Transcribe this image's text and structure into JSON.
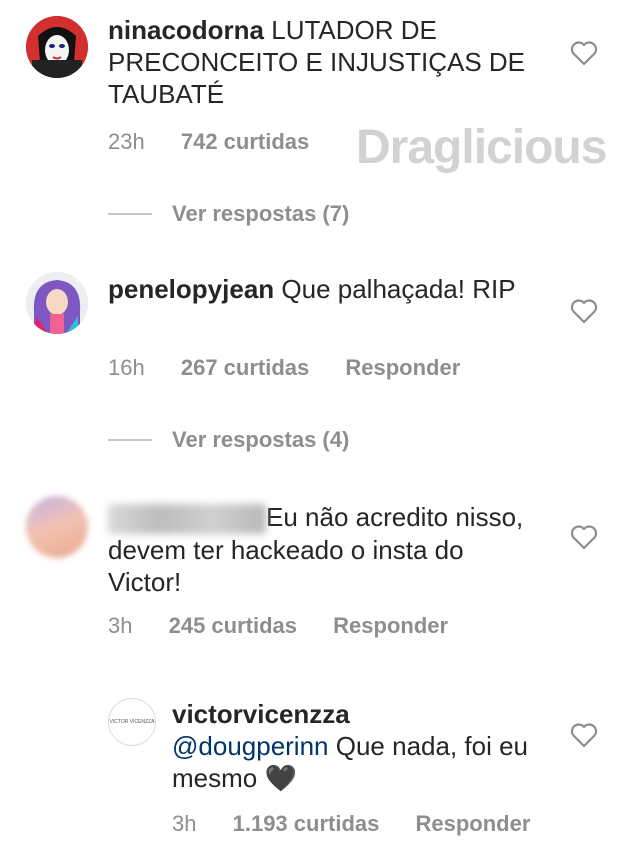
{
  "watermark": "Draglicious",
  "comments": [
    {
      "username": "ninacodorna",
      "text": " LUTADOR DE PRECONCEITO E INJUSTIÇAS DE TAUBATÉ",
      "time": "23h",
      "likes": "742 curtidas",
      "reply_label": "",
      "view_replies": "Ver respostas (7)",
      "avatar_icon": "drag-queen-avatar"
    },
    {
      "username": "penelopyjean",
      "text": " Que palhaçada! RIP",
      "time": "16h",
      "likes": "267 curtidas",
      "reply_label": "Responder",
      "view_replies": "Ver respostas (4)",
      "avatar_icon": "colorful-hair-avatar"
    },
    {
      "username": "",
      "text": "Eu não acredito nisso, devem ter hackeado o insta do Victor!",
      "time": "3h",
      "likes": "245 curtidas",
      "reply_label": "Responder",
      "avatar_icon": "blurred-avatar"
    },
    {
      "username": "victorvicenzza",
      "mention": "@dougperinn",
      "text": " Que nada, foi eu mesmo 🖤",
      "time": "3h",
      "likes": "1.193 curtidas",
      "reply_label": "Responder",
      "avatar_text": "VICTOR VICENZZA"
    }
  ],
  "colors": {
    "meta": "#8e8e8e",
    "text": "#262626",
    "mention": "#003569"
  }
}
